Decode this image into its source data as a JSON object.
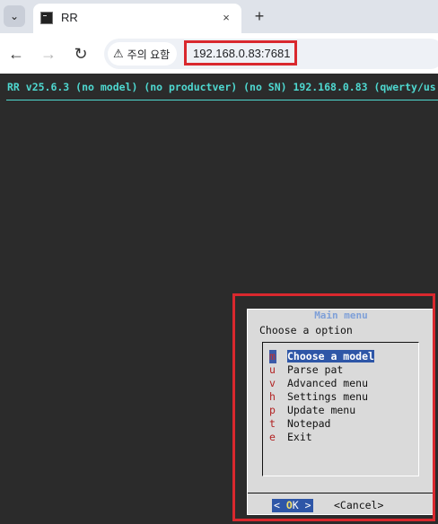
{
  "browser": {
    "tab_title": "RR",
    "tab_close_icon": "×",
    "new_tab_icon": "+",
    "tab_dropdown_icon": "⌄",
    "security_label": "주의 요함",
    "warning_icon": "⚠",
    "url": "192.168.0.83:7681",
    "back_icon": "←",
    "forward_icon": "→",
    "reload_icon": "↻"
  },
  "terminal": {
    "header_line": "RR v25.6.3 (no model) (no productver) (no SN) 192.168.0.83 (qwerty/us",
    "text_color": "#4ed8d0",
    "background": "#2b2b2b"
  },
  "dialog": {
    "title": "Main menu",
    "prompt": "Choose a option",
    "items": [
      {
        "tag": "m",
        "label": "Choose a model"
      },
      {
        "tag": "u",
        "label": "Parse pat"
      },
      {
        "tag": "v",
        "label": "Advanced menu"
      },
      {
        "tag": "h",
        "label": "Settings menu"
      },
      {
        "tag": "p",
        "label": "Update menu"
      },
      {
        "tag": "t",
        "label": "Notepad"
      },
      {
        "tag": "e",
        "label": "Exit"
      }
    ],
    "selected_index": 0,
    "ok": {
      "left": "< ",
      "hot": "O",
      "rest": "K",
      "right": "  >"
    },
    "cancel_label": "<Cancel>"
  }
}
